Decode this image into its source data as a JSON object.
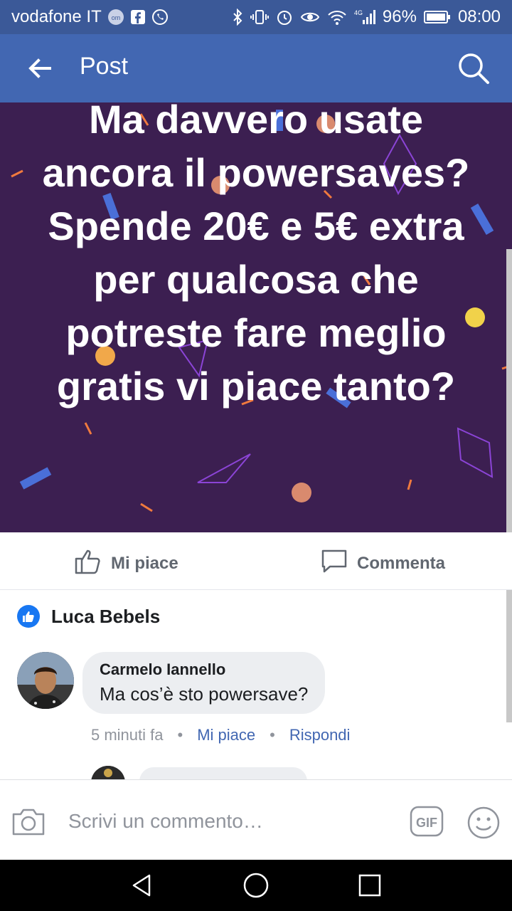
{
  "status_bar": {
    "carrier": "vodafone IT",
    "battery": "96%",
    "network": "4G",
    "time": "08:00"
  },
  "appbar": {
    "title": "Post"
  },
  "post": {
    "text": "Ma davvero usate ancora il powersaves? Spende 20€ e 5€ extra per qualcosa che potreste fare meglio gratis vi piace tanto?",
    "background_color": "#3c1f51"
  },
  "actions": {
    "like_label": "Mi piace",
    "comment_label": "Commenta"
  },
  "likes": {
    "name": "Luca Bebels"
  },
  "comment": {
    "author": "Carmelo Iannello",
    "text": "Ma cos’è sto powersave?",
    "time": "5 minuti fa",
    "like_label": "Mi piace",
    "reply_label": "Rispondi"
  },
  "composer": {
    "placeholder": "Scrivi un commento…",
    "gif_label": "GIF"
  },
  "colors": {
    "brand": "#4267b2",
    "status_bar": "#3b5998",
    "accent_blue": "#1877f2"
  }
}
